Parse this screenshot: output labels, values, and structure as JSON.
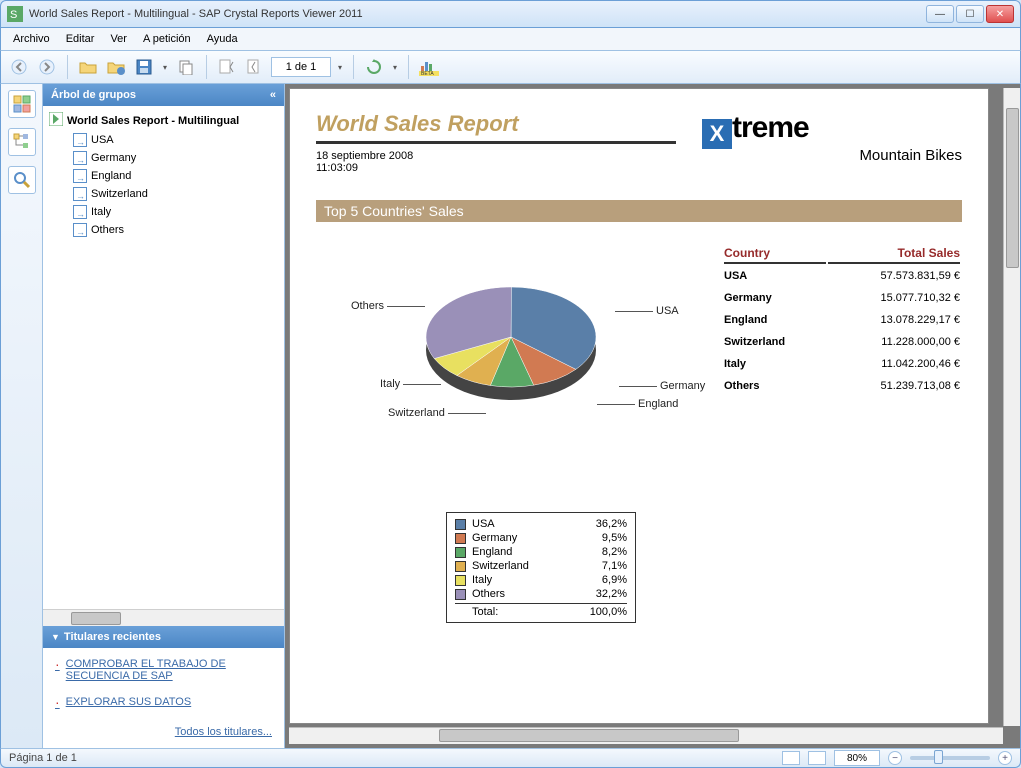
{
  "window_title": "World Sales Report - Multilingual - SAP Crystal Reports Viewer 2011",
  "menu": {
    "archivo": "Archivo",
    "editar": "Editar",
    "ver": "Ver",
    "apeticion": "A petición",
    "ayuda": "Ayuda"
  },
  "toolbar": {
    "page_of": "1 de 1"
  },
  "sidebar": {
    "header": "Árbol de grupos",
    "root": "World Sales Report - Multilingual",
    "items": [
      "USA",
      "Germany",
      "England",
      "Switzerland",
      "Italy",
      "Others"
    ],
    "recent_header": "Titulares recientes",
    "recent_links": [
      "COMPROBAR EL TRABAJO DE SECUENCIA DE SAP",
      "EXPLORAR SUS DATOS"
    ],
    "all_headlines": "Todos los titulares..."
  },
  "report": {
    "title": "World Sales Report",
    "date": "18 septiembre 2008",
    "time": "11:03:09",
    "logo_text": "treme",
    "logo_sub": "Mountain Bikes",
    "section": "Top 5 Countries' Sales",
    "th_country": "Country",
    "th_total": "Total Sales",
    "rows": [
      {
        "c": "USA",
        "v": "57.573.831,59 €"
      },
      {
        "c": "Germany",
        "v": "15.077.710,32 €"
      },
      {
        "c": "England",
        "v": "13.078.229,17 €"
      },
      {
        "c": "Switzerland",
        "v": "11.228.000,00 €"
      },
      {
        "c": "Italy",
        "v": "11.042.200,46 €"
      },
      {
        "c": "Others",
        "v": "51.239.713,08 €"
      }
    ],
    "legend_total_label": "Total:",
    "legend_total_pct": "100,0%"
  },
  "chart_data": {
    "type": "pie",
    "title": "Top 5 Countries' Sales",
    "series": [
      {
        "name": "USA",
        "pct": 36.2,
        "pct_label": "36,2%",
        "color": "#5a7fa8"
      },
      {
        "name": "Germany",
        "pct": 9.5,
        "pct_label": "9,5%",
        "color": "#d17a52"
      },
      {
        "name": "England",
        "pct": 8.2,
        "pct_label": "8,2%",
        "color": "#5aa866"
      },
      {
        "name": "Switzerland",
        "pct": 7.1,
        "pct_label": "7,1%",
        "color": "#e0b050"
      },
      {
        "name": "Italy",
        "pct": 6.9,
        "pct_label": "6,9%",
        "color": "#e8e060"
      },
      {
        "name": "Others",
        "pct": 32.2,
        "pct_label": "32,2%",
        "color": "#9a90b8"
      }
    ]
  },
  "status": {
    "page": "Página 1 de 1",
    "zoom": "80%"
  }
}
